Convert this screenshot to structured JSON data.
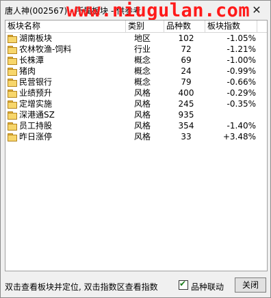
{
  "window": {
    "title": "唐人神(002567) - 所属板块 - 供参考",
    "watermark": "www.niugulan.com",
    "close_glyph": "✕"
  },
  "table": {
    "columns": [
      "板块名称",
      "类别",
      "品种数",
      "板块指数"
    ],
    "rows": [
      {
        "name": "湖南板块",
        "type": "地区",
        "count": "102",
        "index": "-1.05%"
      },
      {
        "name": "农林牧渔-饲料",
        "type": "行业",
        "count": "72",
        "index": "-1.21%"
      },
      {
        "name": "长株潭",
        "type": "概念",
        "count": "69",
        "index": "-1.00%"
      },
      {
        "name": "猪肉",
        "type": "概念",
        "count": "24",
        "index": "-0.99%"
      },
      {
        "name": "民营银行",
        "type": "概念",
        "count": "79",
        "index": "-0.66%"
      },
      {
        "name": "业绩预升",
        "type": "风格",
        "count": "400",
        "index": "-0.29%"
      },
      {
        "name": "定增实施",
        "type": "风格",
        "count": "245",
        "index": "-0.35%"
      },
      {
        "name": "深港通SZ",
        "type": "风格",
        "count": "935",
        "index": ""
      },
      {
        "name": "员工持股",
        "type": "风格",
        "count": "354",
        "index": "-1.40%"
      },
      {
        "name": "昨日涨停",
        "type": "风格",
        "count": "33",
        "index": "+3.48%"
      }
    ]
  },
  "footer": {
    "hint": "双击查看板块并定位, 双击指数区查看指数",
    "checkbox_label": "品种联动",
    "checkbox_checked": true,
    "close_label": "关闭"
  },
  "colors": {
    "watermark": "#ff1a1a",
    "folder": "#f7d66b"
  }
}
